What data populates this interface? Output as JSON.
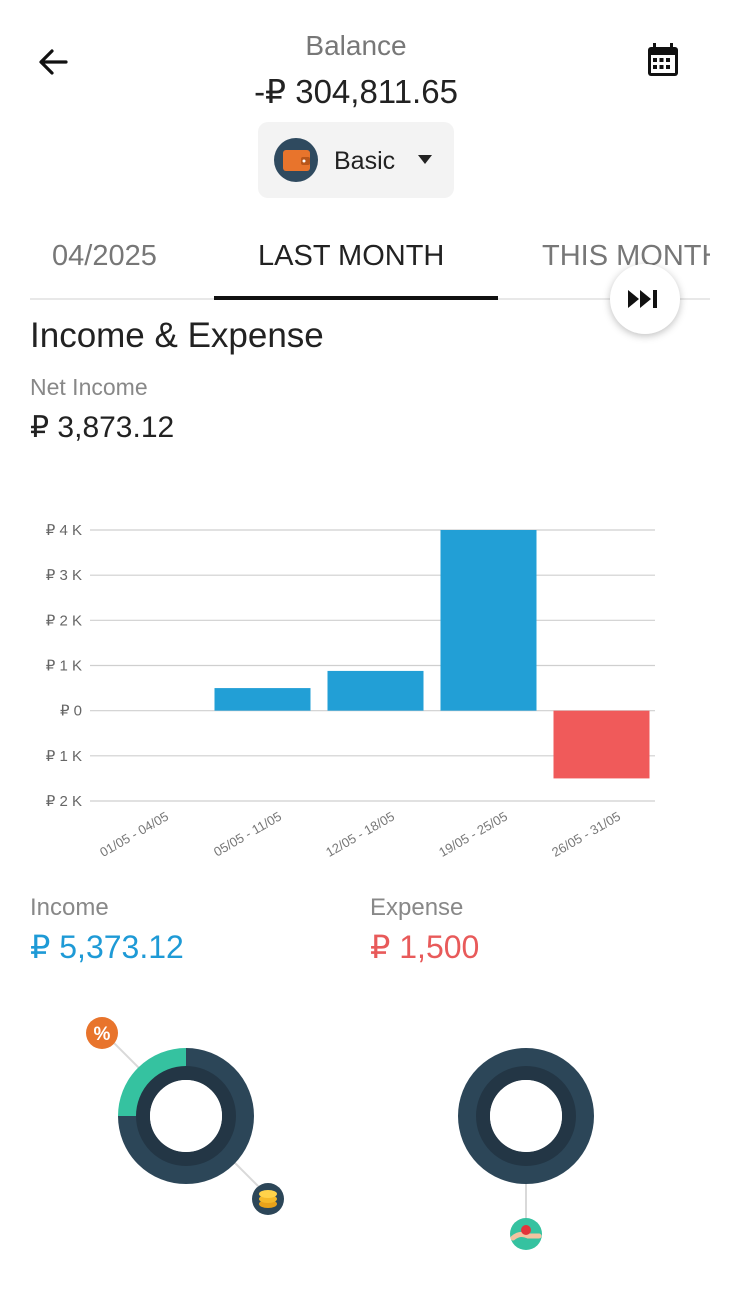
{
  "header": {
    "balance_label": "Balance",
    "balance_value": "-₽ 304,811.65",
    "wallet_label": "Basic"
  },
  "tabs": [
    {
      "label": "04/2025",
      "active": false
    },
    {
      "label": "LAST MONTH",
      "active": true
    },
    {
      "label": "THIS MONTH",
      "active": false
    }
  ],
  "section": {
    "title": "Income & Expense",
    "net_label": "Net Income",
    "net_value": "₽ 3,873.12"
  },
  "summary": {
    "income_label": "Income",
    "income_value": "₽ 5,373.12",
    "expense_label": "Expense",
    "expense_value": "₽ 1,500"
  },
  "colors": {
    "income": "#229fd6",
    "expense": "#f05a5a",
    "donut_dark": "#2c4658",
    "donut_inner": "#233645",
    "donut_teal": "#35c2a0",
    "badge_orange": "#e8742c"
  },
  "icons": [
    "back-arrow-icon",
    "calendar-icon",
    "wallet-icon",
    "skip-forward-icon",
    "percent-icon",
    "coins-icon",
    "hand-heart-icon"
  ],
  "chart_data": {
    "type": "bar",
    "categories": [
      "01/05 - 04/05",
      "05/05 - 11/05",
      "12/05 - 18/05",
      "19/05 - 25/05",
      "26/05 - 31/05"
    ],
    "values": [
      0,
      500,
      880,
      4000,
      -1500
    ],
    "ytick_values": [
      4000,
      3000,
      2000,
      1000,
      0,
      -1000,
      -2000
    ],
    "ytick_labels": [
      "₽ 4 K",
      "₽ 3 K",
      "₽ 2 K",
      "₽ 1 K",
      "₽ 0",
      "₽ 1 K",
      "₽ 2 K"
    ],
    "ylim": [
      -2000,
      4000
    ],
    "grid": true
  },
  "donut_data": [
    {
      "name": "income",
      "segments": [
        {
          "value": 0.75,
          "color": "#2c4658"
        },
        {
          "value": 0.25,
          "color": "#35c2a0"
        }
      ]
    },
    {
      "name": "expense",
      "segments": [
        {
          "value": 1.0,
          "color": "#2c4658"
        }
      ]
    }
  ]
}
